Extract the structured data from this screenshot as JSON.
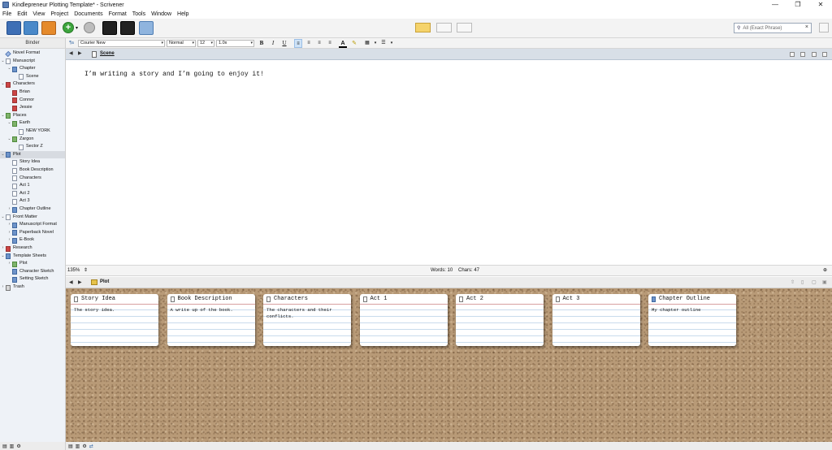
{
  "window": {
    "title": "Kindlepreneur Plotting Template* - Scrivener",
    "controls": [
      "—",
      "❐",
      "✕"
    ]
  },
  "menu": [
    "File",
    "Edit",
    "View",
    "Project",
    "Documents",
    "Format",
    "Tools",
    "Window",
    "Help"
  ],
  "search": {
    "placeholder": "All (Exact Phrase)",
    "clear": "×"
  },
  "binder": {
    "header": "Binder",
    "items": [
      {
        "label": "Novel Format",
        "depth": 0,
        "icon": "warn",
        "arrow": ""
      },
      {
        "label": "Manuscript",
        "depth": 0,
        "icon": "doc",
        "arrow": "v"
      },
      {
        "label": "Chapter",
        "depth": 1,
        "icon": "fold",
        "arrow": "v"
      },
      {
        "label": "Scene",
        "depth": 2,
        "icon": "doc",
        "arrow": ""
      },
      {
        "label": "Characters",
        "depth": 0,
        "icon": "char",
        "arrow": "v"
      },
      {
        "label": "Brian",
        "depth": 1,
        "icon": "char",
        "arrow": ""
      },
      {
        "label": "Connor",
        "depth": 1,
        "icon": "char",
        "arrow": ""
      },
      {
        "label": "Jessie",
        "depth": 1,
        "icon": "char",
        "arrow": ""
      },
      {
        "label": "Places",
        "depth": 0,
        "icon": "pl",
        "arrow": "v"
      },
      {
        "label": "Earth",
        "depth": 1,
        "icon": "pl",
        "arrow": "v"
      },
      {
        "label": "NEW YORK",
        "depth": 2,
        "icon": "doc",
        "arrow": ""
      },
      {
        "label": "Zargon",
        "depth": 1,
        "icon": "pl",
        "arrow": "v"
      },
      {
        "label": "Sector Z",
        "depth": 2,
        "icon": "doc",
        "arrow": ""
      },
      {
        "label": "Plot",
        "depth": 0,
        "icon": "fold",
        "arrow": "v",
        "selected": true
      },
      {
        "label": "Story Idea",
        "depth": 1,
        "icon": "doc",
        "arrow": ""
      },
      {
        "label": "Book Description",
        "depth": 1,
        "icon": "doc",
        "arrow": ""
      },
      {
        "label": "Characters",
        "depth": 1,
        "icon": "doc",
        "arrow": ""
      },
      {
        "label": "Act 1",
        "depth": 1,
        "icon": "doc",
        "arrow": ""
      },
      {
        "label": "Act 2",
        "depth": 1,
        "icon": "doc",
        "arrow": ""
      },
      {
        "label": "Act 3",
        "depth": 1,
        "icon": "doc",
        "arrow": ""
      },
      {
        "label": "Chapter Outline",
        "depth": 1,
        "icon": "fold",
        "arrow": ">"
      },
      {
        "label": "Front Matter",
        "depth": 0,
        "icon": "doc",
        "arrow": "v"
      },
      {
        "label": "Manuscript Format",
        "depth": 1,
        "icon": "fold",
        "arrow": ">"
      },
      {
        "label": "Paperback Novel",
        "depth": 1,
        "icon": "fold",
        "arrow": ">"
      },
      {
        "label": "E-Book",
        "depth": 1,
        "icon": "fold",
        "arrow": ">"
      },
      {
        "label": "Research",
        "depth": 0,
        "icon": "char",
        "arrow": ">"
      },
      {
        "label": "Template Sheets",
        "depth": 0,
        "icon": "fold",
        "arrow": "v"
      },
      {
        "label": "Plot",
        "depth": 1,
        "icon": "pl",
        "arrow": ">"
      },
      {
        "label": "Character Sketch",
        "depth": 1,
        "icon": "fold",
        "arrow": ""
      },
      {
        "label": "Setting Sketch",
        "depth": 1,
        "icon": "fold",
        "arrow": ""
      },
      {
        "label": "Trash",
        "depth": 0,
        "icon": "trash",
        "arrow": ">"
      }
    ]
  },
  "format": {
    "font": "Courier New",
    "style": "Normal",
    "size": "12",
    "spacing": "1.0x",
    "bold": "B",
    "italic": "I",
    "underline": "U"
  },
  "editor": {
    "title": "Scene",
    "text": "I’m writing a story and I’m going to enjoy it!",
    "zoom": "135%",
    "words": "Words: 10",
    "chars": "Chars: 47"
  },
  "corkboard": {
    "title": "Plot",
    "cards": [
      {
        "title": "Story Idea",
        "synopsis": "The story idea.",
        "folder": false
      },
      {
        "title": "Book Description",
        "synopsis": "A write up of the book.",
        "folder": false
      },
      {
        "title": "Characters",
        "synopsis": "The characters and their conflicts.",
        "folder": false
      },
      {
        "title": "Act 1",
        "synopsis": "",
        "folder": false
      },
      {
        "title": "Act 2",
        "synopsis": "",
        "folder": false
      },
      {
        "title": "Act 3",
        "synopsis": "",
        "folder": false
      },
      {
        "title": "Chapter Outline",
        "synopsis": "My chapter outline",
        "folder": true
      }
    ]
  }
}
